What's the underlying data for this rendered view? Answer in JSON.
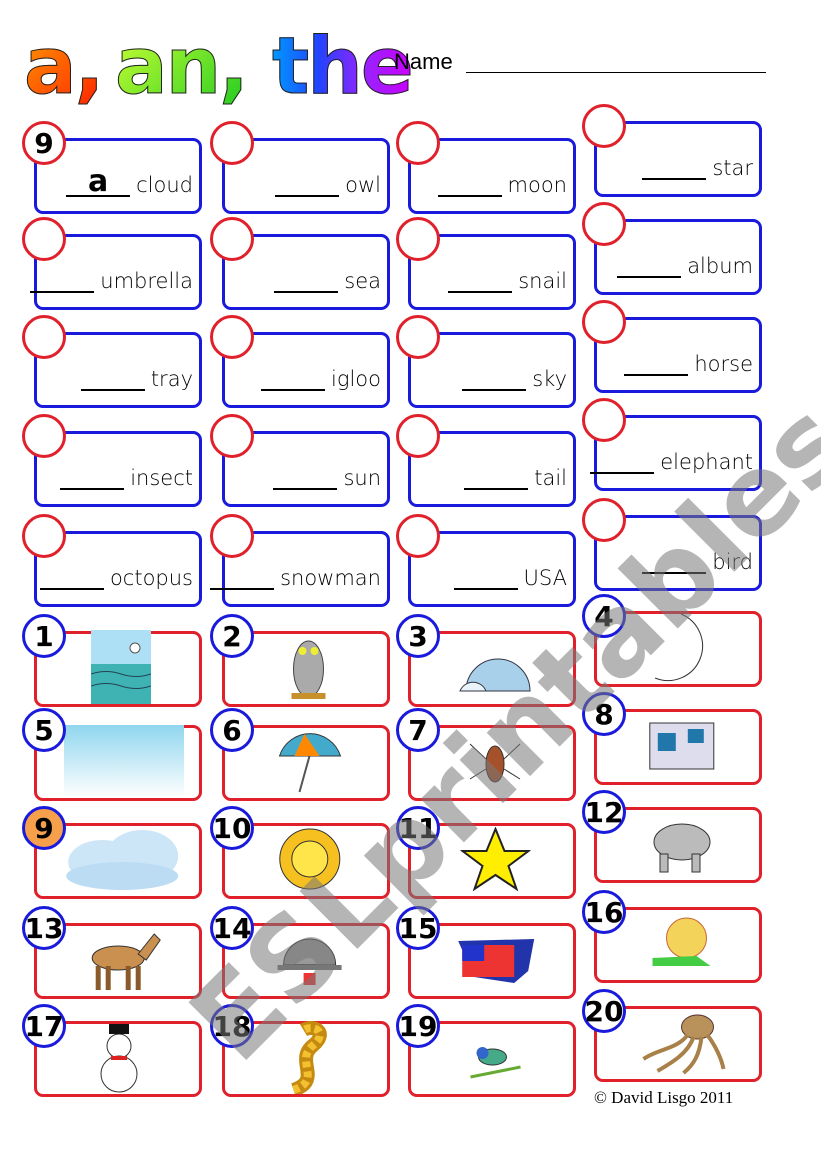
{
  "title": {
    "a": "a,",
    "an": "an,",
    "the": "the"
  },
  "name_label": "Name",
  "answer_items": [
    {
      "number": "9",
      "answer": "a",
      "word": "cloud"
    },
    {
      "number": "",
      "answer": "",
      "word": "owl"
    },
    {
      "number": "",
      "answer": "",
      "word": "moon"
    },
    {
      "number": "",
      "answer": "",
      "word": "star"
    },
    {
      "number": "",
      "answer": "",
      "word": "umbrella"
    },
    {
      "number": "",
      "answer": "",
      "word": "sea"
    },
    {
      "number": "",
      "answer": "",
      "word": "snail"
    },
    {
      "number": "",
      "answer": "",
      "word": "album"
    },
    {
      "number": "",
      "answer": "",
      "word": "tray"
    },
    {
      "number": "",
      "answer": "",
      "word": "igloo"
    },
    {
      "number": "",
      "answer": "",
      "word": "sky"
    },
    {
      "number": "",
      "answer": "",
      "word": "horse"
    },
    {
      "number": "",
      "answer": "",
      "word": "insect"
    },
    {
      "number": "",
      "answer": "",
      "word": "sun"
    },
    {
      "number": "",
      "answer": "",
      "word": "tail"
    },
    {
      "number": "",
      "answer": "",
      "word": "elephant"
    },
    {
      "number": "",
      "answer": "",
      "word": "octopus"
    },
    {
      "number": "",
      "answer": "",
      "word": "snowman"
    },
    {
      "number": "",
      "answer": "",
      "word": "USA"
    },
    {
      "number": "",
      "answer": "",
      "word": "bird"
    }
  ],
  "picture_items": [
    {
      "number": "1",
      "picture": "sea"
    },
    {
      "number": "2",
      "picture": "owl"
    },
    {
      "number": "3",
      "picture": "igloo"
    },
    {
      "number": "4",
      "picture": "moon"
    },
    {
      "number": "5",
      "picture": "sky"
    },
    {
      "number": "6",
      "picture": "umbrella"
    },
    {
      "number": "7",
      "picture": "insect"
    },
    {
      "number": "8",
      "picture": "album"
    },
    {
      "number": "9",
      "picture": "cloud",
      "highlighted": true
    },
    {
      "number": "10",
      "picture": "sun"
    },
    {
      "number": "11",
      "picture": "star"
    },
    {
      "number": "12",
      "picture": "elephant"
    },
    {
      "number": "13",
      "picture": "horse"
    },
    {
      "number": "14",
      "picture": "tray"
    },
    {
      "number": "15",
      "picture": "USA"
    },
    {
      "number": "16",
      "picture": "snail"
    },
    {
      "number": "17",
      "picture": "snowman"
    },
    {
      "number": "18",
      "picture": "tail"
    },
    {
      "number": "19",
      "picture": "bird"
    },
    {
      "number": "20",
      "picture": "octopus"
    }
  ],
  "watermark": "ESLprintables.com",
  "copyright": "© David Lisgo 2011",
  "colors": {
    "answer_box_border": "#1a1adc",
    "answer_circle": "#e0202a",
    "picture_box_border": "#e0202a",
    "picture_circle": "#1a1adc",
    "highlight": "#f7a04b"
  }
}
